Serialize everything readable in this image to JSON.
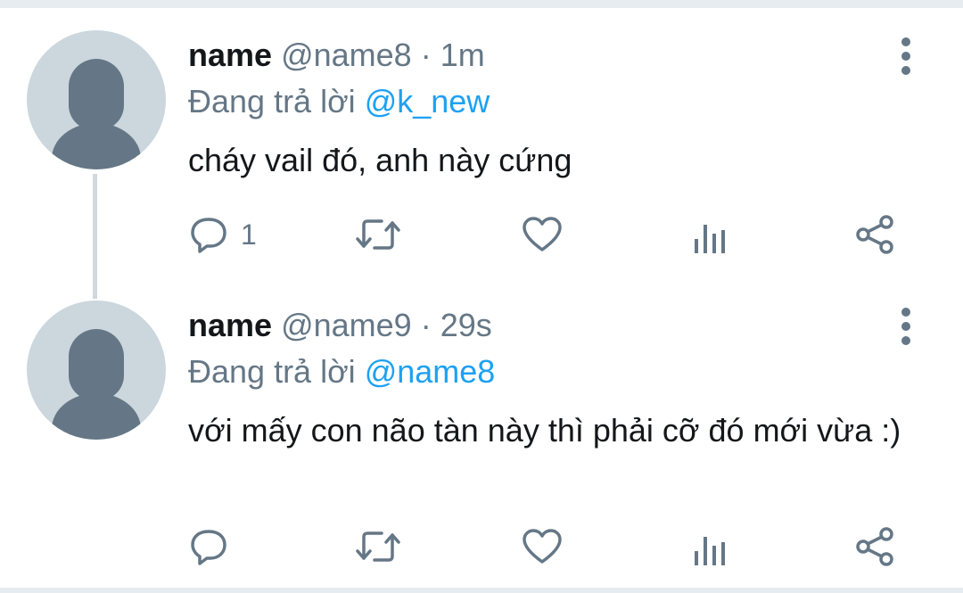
{
  "tweets": [
    {
      "display_name": "name",
      "handle": "@name8",
      "sep": " · ",
      "time": "1m",
      "replying_prefix": "Đang trả lời ",
      "replying_to": "@k_new",
      "text": "cháy vail đó, anh này cứng",
      "reply_count": "1",
      "icons": [
        "reply-icon",
        "retweet-icon",
        "like-icon",
        "analytics-icon",
        "share-icon",
        "more-icon"
      ]
    },
    {
      "display_name": "name",
      "handle": "@name9",
      "sep": " · ",
      "time": "29s",
      "replying_prefix": "Đang trả lời ",
      "replying_to": "@name8",
      "text": "với mấy con não tàn này thì phải cỡ đó mới vừa :)",
      "reply_count": "",
      "icons": [
        "reply-icon",
        "retweet-icon",
        "like-icon",
        "analytics-icon",
        "share-icon",
        "more-icon"
      ]
    }
  ],
  "colors": {
    "primary_text": "#14171a",
    "secondary_text": "#657786",
    "link": "#1da1f2",
    "avatar_bg": "#ccd6dd",
    "thread_line": "#cfd9de"
  }
}
